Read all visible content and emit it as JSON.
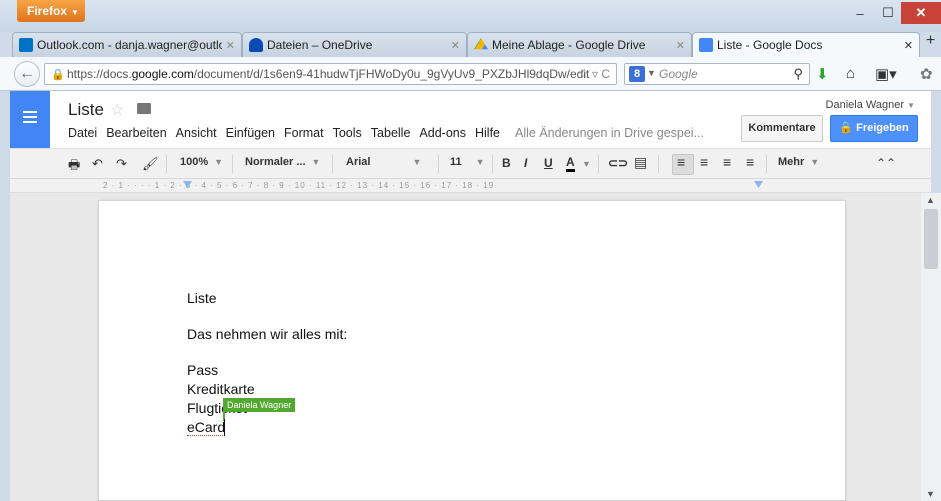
{
  "browser": {
    "menu_label": "Firefox",
    "tabs": [
      {
        "label": "Outlook.com - danja.wagner@outlo...",
        "icon_color": "#0072c6"
      },
      {
        "label": "Dateien – OneDrive",
        "icon_color": "#094ab2"
      },
      {
        "label": "Meine Ablage - Google Drive",
        "icon_color": "#f4b400"
      },
      {
        "label": "Liste - Google Docs",
        "icon_color": "#4285f4"
      }
    ],
    "url_prefix": "https://docs.",
    "url_domain": "google.com",
    "url_path": "/document/d/1s6en9-41hudwTjFHWoDy0u_9gVyUv9_PXZbJHl9dqDw/edit",
    "search_placeholder": "Google"
  },
  "docs": {
    "title": "Liste",
    "menu": [
      "Datei",
      "Bearbeiten",
      "Ansicht",
      "Einfügen",
      "Format",
      "Tools",
      "Tabelle",
      "Add-ons",
      "Hilfe"
    ],
    "save_status": "Alle Änderungen in Drive gespei...",
    "user_name": "Daniela Wagner",
    "comments_label": "Kommentare",
    "share_label": "Freigeben",
    "toolbar": {
      "zoom": "100%",
      "style": "Normaler ...",
      "font": "Arial",
      "size": "11",
      "more": "Mehr"
    },
    "ruler_text": "2 · 1 · · · · 1 · 2 · 3 · 4 · 5 · 6 · 7 · 8 · 9 · 10 · 11 · 12 · 13 · 14 · 15 · 16 · 17 · 18 · 19",
    "content": [
      "Liste",
      "Das nehmen wir alles mit:",
      "Pass",
      "Kreditkarte",
      "Flugticket",
      "eCard"
    ],
    "collaborator_label": "Daniela Wagner"
  },
  "colors": {
    "docs_blue": "#4285f4",
    "share_blue": "#4d90fe",
    "collaborator_green": "#52a830"
  }
}
